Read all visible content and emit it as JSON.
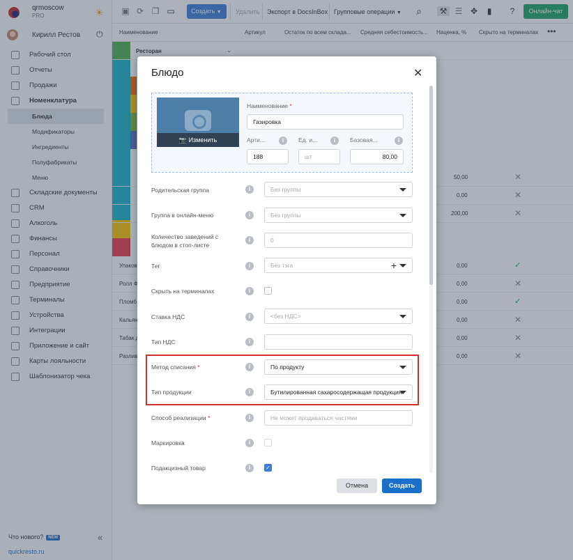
{
  "brand": {
    "name": "qrmoscow",
    "plan": "PRO"
  },
  "user": {
    "name": "Кирилл Рестов"
  },
  "nav": [
    {
      "label": "Рабочий стол"
    },
    {
      "label": "Отчеты"
    },
    {
      "label": "Продажи"
    },
    {
      "label": "Номенклатура"
    },
    {
      "label": "Складские документы"
    },
    {
      "label": "CRM"
    },
    {
      "label": "Алкоголь"
    },
    {
      "label": "Финансы"
    },
    {
      "label": "Персонал"
    },
    {
      "label": "Справочники"
    },
    {
      "label": "Предприятие"
    },
    {
      "label": "Терминалы"
    },
    {
      "label": "Устройства"
    },
    {
      "label": "Интеграции"
    },
    {
      "label": "Приложение и сайт"
    },
    {
      "label": "Карты лояльности"
    },
    {
      "label": "Шаблонизатор чека"
    }
  ],
  "nav_sub": [
    "Блюда",
    "Модификаторы",
    "Ингредиенты",
    "Полуфабрикаты",
    "Меню"
  ],
  "footer": {
    "whatsnew": "Что нового?",
    "badge": "NEW",
    "site": "quickresto.ru"
  },
  "toolbar": {
    "create": "Создать",
    "delete": "Удалить",
    "export": "Экспорт в DocsInBox",
    "group_ops": "Групповые операции",
    "chat": "Онлайн-чат"
  },
  "table": {
    "headers": [
      "Наименование",
      "Артикул",
      "Остаток по всем склада...",
      "Средняя себестоимость...",
      "Наценка, %",
      "Скрыто на терминалах"
    ],
    "group": "Ресторан",
    "rows": [
      {
        "name": "",
        "cost": "50,00",
        "hidden": "x"
      },
      {
        "name": "",
        "cost": "0,00",
        "hidden": "x"
      },
      {
        "name": "",
        "cost": "200,00",
        "hidden": "x"
      },
      {
        "name": "Упаков",
        "cost": "0,00",
        "hidden": "check"
      },
      {
        "name": "Ролл Ф",
        "cost": "0,00",
        "hidden": "x"
      },
      {
        "name": "Пломб",
        "cost": "0,00",
        "hidden": "check"
      },
      {
        "name": "Кальян",
        "cost": "0,00",
        "hidden": "x"
      },
      {
        "name": "Табак д",
        "cost": "0,00",
        "hidden": "x"
      },
      {
        "name": "Разлив",
        "cost": "0,00",
        "hidden": "x"
      }
    ]
  },
  "modal": {
    "title": "Блюдо",
    "photo_button": "Изменить",
    "name_label": "Наименование",
    "name_value": "Газировка",
    "article_label": "Арти...",
    "article_value": "188",
    "unit_label": "Ед. и...",
    "unit_placeholder": "шт",
    "price_label": "Базовая...",
    "price_value": "80,00",
    "fields": [
      {
        "label": "Родительская группа",
        "value": "Без группы"
      },
      {
        "label": "Группа в онлайн-меню",
        "value": "Без группы"
      },
      {
        "label": "Количество заведений с блюдом в стоп-листе",
        "value": "0"
      },
      {
        "label": "Тег",
        "value": "Без тэга"
      },
      {
        "label": "Скрыть на терминалах",
        "value": ""
      },
      {
        "label": "Ставка НДС",
        "value": "<без НДС>"
      },
      {
        "label": "Тип НДС",
        "value": ""
      },
      {
        "label": "Метод списания",
        "value": "По продукту"
      },
      {
        "label": "Тип продукции",
        "value": "Бутилированная сахаросодержащая продукция"
      },
      {
        "label": "Способ реализации",
        "value": "Не может продаваться частями"
      },
      {
        "label": "Маркировка",
        "value": ""
      },
      {
        "label": "Подакцизный товар",
        "value": ""
      }
    ],
    "cancel": "Отмена",
    "submit": "Создать"
  },
  "colors": {
    "accent": "#1a6fc9",
    "chat": "#1aa364",
    "highlight": "#d32f2f"
  }
}
